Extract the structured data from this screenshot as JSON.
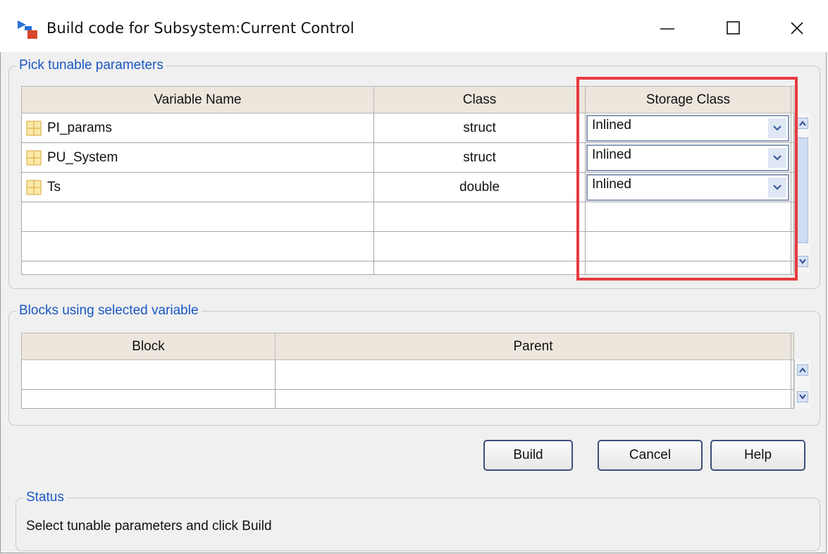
{
  "window": {
    "title": "Build code for Subsystem:Current Control",
    "minimize_glyph": "—",
    "maximize_glyph": "☐",
    "close_glyph": "✕"
  },
  "tunable_group": {
    "legend": "Pick tunable parameters",
    "columns": [
      "Variable Name",
      "Class",
      "Storage Class"
    ],
    "rows": [
      {
        "name": "PI_params",
        "class": "struct",
        "storage": "Inlined"
      },
      {
        "name": "PU_System",
        "class": "struct",
        "storage": "Inlined"
      },
      {
        "name": "Ts",
        "class": "double",
        "storage": "Inlined"
      }
    ],
    "empty_rows": 3
  },
  "blocks_group": {
    "legend": "Blocks using selected variable",
    "columns": [
      "Block",
      "Parent"
    ]
  },
  "buttons": {
    "build": "Build",
    "cancel": "Cancel",
    "help": "Help"
  },
  "status_group": {
    "legend": "Status",
    "message": "Select tunable parameters and click Build"
  },
  "colors": {
    "legend_blue": "#1a57c4",
    "highlight_red": "#e83a3f",
    "header_bg": "#ece6dd"
  },
  "icons": {
    "app": "simulink-build-icon",
    "struct": "struct-grid-icon",
    "dropdown": "chevron-down-icon"
  }
}
